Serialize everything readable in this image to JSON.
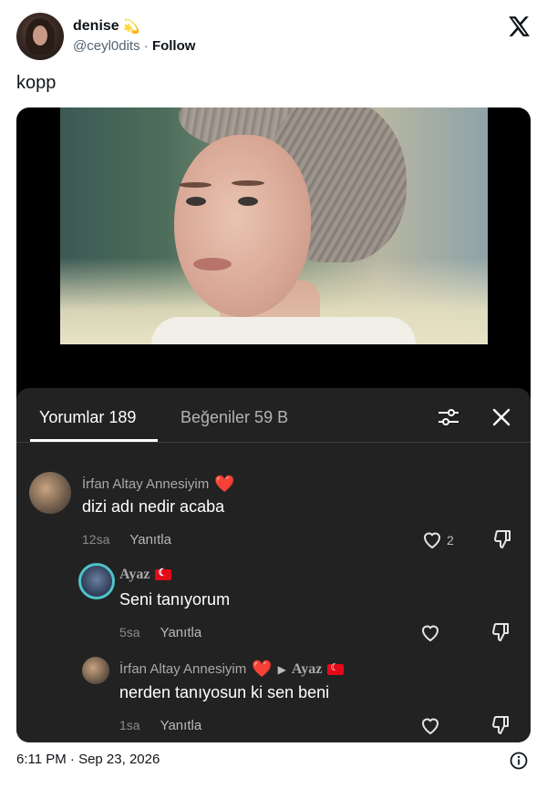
{
  "user": {
    "display_name": "denise",
    "name_emoji": "💫",
    "handle": "@ceyl0dits",
    "separator": "·",
    "follow_label": "Follow"
  },
  "tweet": {
    "text": "kopp"
  },
  "comments_panel": {
    "tab_comments": "Yorumlar 189",
    "tab_likes": "Beğeniler 59 B",
    "comments": [
      {
        "author": "İrfan Altay Annesiyim",
        "author_emoji": "❤️",
        "text": "dizi adı nedir acaba",
        "time": "12sa",
        "reply_label": "Yanıtla",
        "likes": "2"
      },
      {
        "author": "Ayaz",
        "text": "Seni tanıyorum",
        "time": "5sa",
        "reply_label": "Yanıtla"
      },
      {
        "author": "İrfan Altay Annesiyim",
        "author_emoji": "❤️",
        "reply_to": "Ayaz",
        "text": "nerden tanıyosun ki sen beni",
        "time": "1sa",
        "reply_label": "Yanıtla"
      }
    ]
  },
  "footer": {
    "timestamp": "6:11 PM · Sep 23, 2026"
  },
  "icons": [
    "x-logo-icon",
    "filter-icon",
    "close-icon",
    "heart-icon",
    "dislike-icon",
    "info-icon",
    "turkey-flag-icon"
  ],
  "colors": {
    "panel_bg": "#222222",
    "text_primary": "#0f1419",
    "muted": "#536471"
  }
}
